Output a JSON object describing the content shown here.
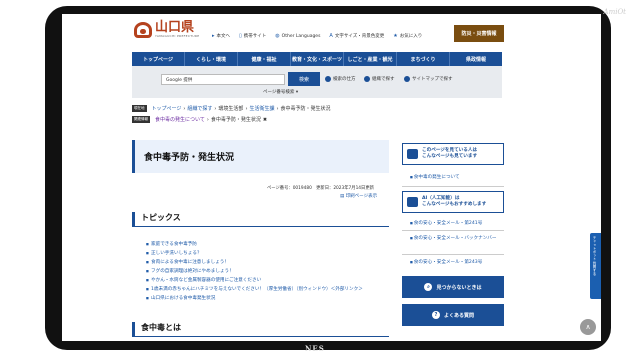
{
  "watermark": "AmiOt",
  "tv_brand": "NES",
  "header": {
    "logo_text": "山口県",
    "logo_sub": "YAMAGUCHI PREFECTURE",
    "links": [
      {
        "icon": "reading-icon",
        "label": "本文へ"
      },
      {
        "icon": "mobile-icon",
        "label": "携帯サイト"
      },
      {
        "icon": "globe-icon",
        "label": "Other Languages"
      },
      {
        "icon": "text-size-icon",
        "label": "文字サイズ・背景色変更"
      },
      {
        "icon": "star-icon",
        "label": "お気に入り"
      }
    ],
    "disaster_button": "防災・災害情報"
  },
  "nav": [
    "トップページ",
    "くらし・環境",
    "健康・福祉",
    "教育・文化・スポーツ",
    "しごと・産業・観光",
    "まちづくり",
    "県政情報"
  ],
  "search": {
    "value": "Google 提供",
    "button": "検索",
    "option1": "検索の仕方",
    "option2": "組織で探す",
    "option3": "サイトマップで探す",
    "page_no": "ページ番号検索 ▾"
  },
  "breadcrumb1": {
    "tag": "現在地",
    "items": [
      "トップページ",
      "組織で探す",
      "環境生活部",
      "生活衛生課",
      "食中毒予防・発生状況"
    ]
  },
  "breadcrumb2": {
    "tag": "関連情報",
    "items": [
      "食中毒の発生について",
      "食中毒予防・発生状況"
    ]
  },
  "page_title": "食中毒予防・発生状況",
  "meta": "ページ番号：0019480　更新日：2023年7月14日更新",
  "print_link": "印刷ページ表示",
  "topics_heading": "トピックス",
  "topics": [
    "家庭できる食中毒予防",
    "正しい手洗いしちょる？",
    "食肉による食中毒に注意しましょう！",
    "フグの自家調理は絶対にやめましょう！",
    "やかん・水筒など金属製容器の使用にご注意ください",
    "1歳未満の赤ちゃんにハチミツを与えないでください！（厚生労働省）（別ウィンドウ）＜外部リンク＞",
    "山口県における食中毒発生状況"
  ],
  "about_heading": "食中毒とは",
  "side": {
    "box1": "このページを見ている人は\nこんなページも見ています",
    "link1": "食中毒の発生について",
    "box2": "AI（人工知能）は\nこんなページもおすすめします",
    "links2": [
      "食の安心・安全メール・第241号",
      "食の安心・安全メール・バックナンバー",
      "食の安心・安全メール・第243号"
    ],
    "btn1": "見つからないときは",
    "btn2": "よくある質問"
  },
  "chatbot": "チャットボット 質問する",
  "to_top": "∧"
}
